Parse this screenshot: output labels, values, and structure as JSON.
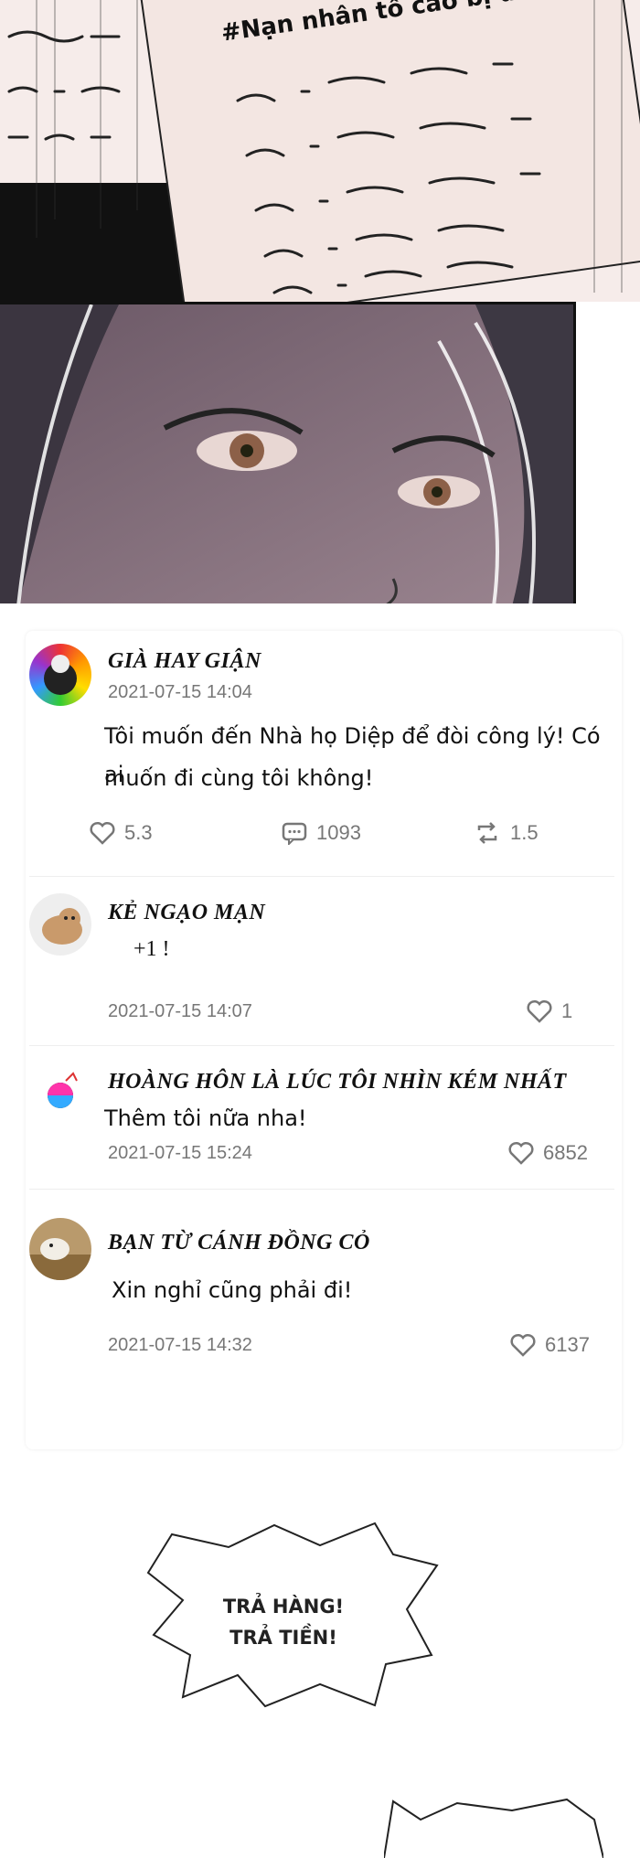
{
  "panel_top": {
    "hashtag": "#Nạn nhân tố cáo bị ức hiếp"
  },
  "comments": [
    {
      "username": "Già hay giận",
      "date": "2021-07-15 14:04",
      "text_line1": "Tôi muốn đến Nhà họ Diệp để đòi công lý! Có ai",
      "text_line2": "muốn đi cùng tôi không!",
      "likes": "5.3",
      "replies": "1093",
      "reposts": "1.5"
    },
    {
      "username": "Kẻ ngạo mạn",
      "text": "+1 !",
      "date": "2021-07-15 14:07",
      "likes": "1"
    },
    {
      "username": "Hoàng hôn là lúc tôi nhìn kém nhất",
      "text": "Thêm tôi nữa nha!",
      "date": "2021-07-15 15:24",
      "likes": "6852"
    },
    {
      "username": "Bạn từ cánh đồng cỏ",
      "text": "Xin nghỉ cũng phải đi!",
      "date": "2021-07-15 14:32",
      "likes": "6137"
    }
  ],
  "bubble": {
    "line1": "TRẢ HÀNG!",
    "line2": "TRẢ TIỀN!"
  },
  "icons": {
    "like": "heart-icon",
    "reply": "comment-icon",
    "repost": "repost-icon"
  },
  "colors": {
    "card_bg": "#ffffff",
    "meta_text": "#777777",
    "name_text": "#111111"
  }
}
